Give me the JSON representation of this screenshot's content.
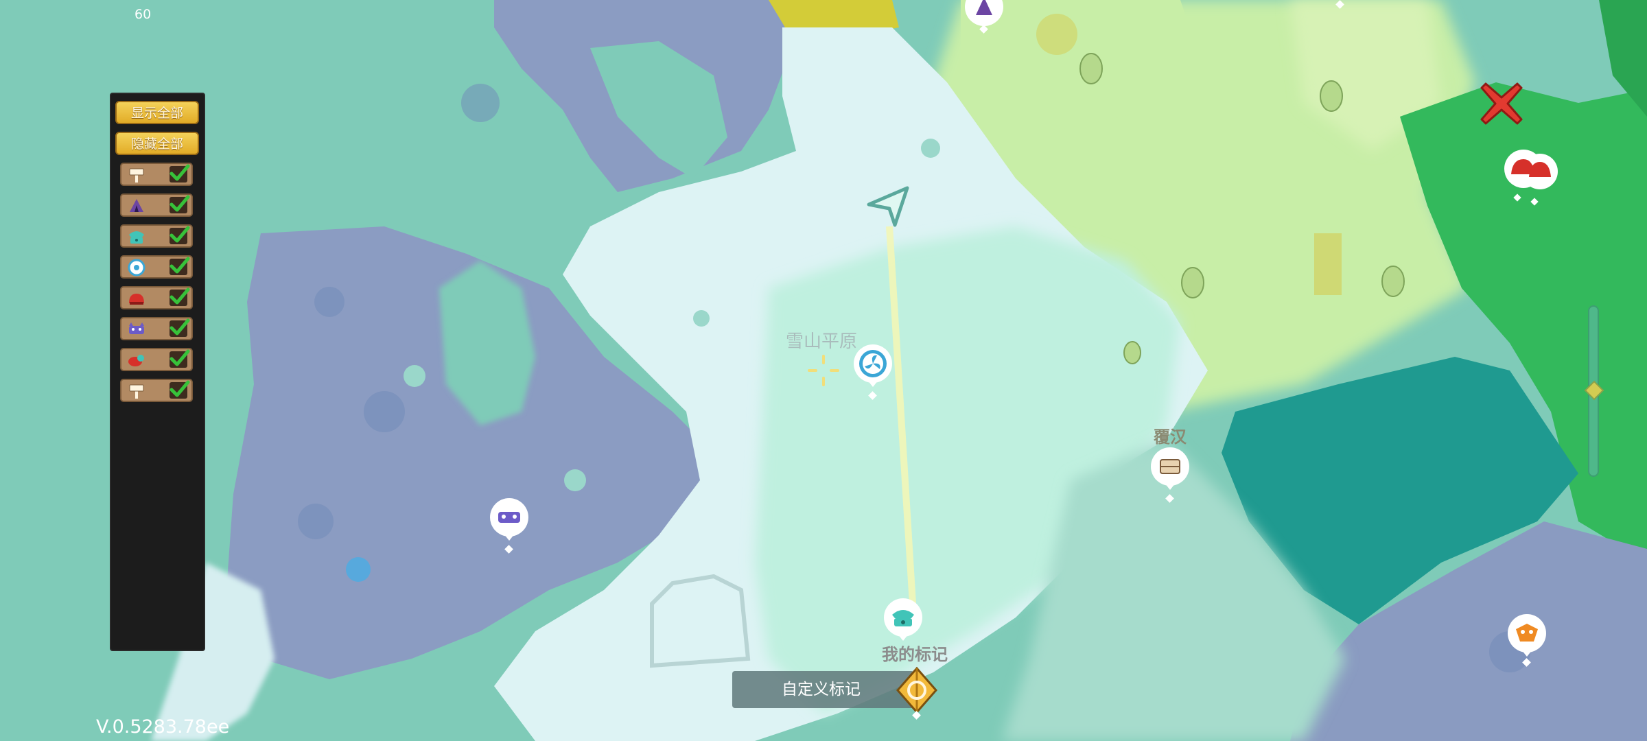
{
  "hud": {
    "fps": "60",
    "version": "V.0.5283.78ee"
  },
  "filter_panel": {
    "show_all": "显示全部",
    "hide_all": "隐藏全部",
    "rows": [
      {
        "icon": "signpost-icon",
        "checked": true
      },
      {
        "icon": "purple-tent-icon",
        "checked": true
      },
      {
        "icon": "teal-phone-icon",
        "checked": true
      },
      {
        "icon": "blue-fan-icon",
        "checked": true
      },
      {
        "icon": "red-monster-icon",
        "checked": true
      },
      {
        "icon": "purple-monster-icon",
        "checked": true
      },
      {
        "icon": "red-creature-icon",
        "checked": true
      },
      {
        "icon": "signpost-icon",
        "checked": true
      }
    ]
  },
  "map": {
    "region_name": "雪山平原",
    "npc_name": "覆汉",
    "my_marker": "我的标记"
  },
  "custom_marker_button": "自定义标记",
  "colors": {
    "panel_bg": "#1c1c1c",
    "gold_button": "#e9b833",
    "check_green": "#37c23a",
    "sea": "#7fcbb8",
    "rock": "#8b9cc2",
    "snow": "#dff4f5",
    "grass_light": "#bfe9a0",
    "forest": "#2fb35a",
    "deep_water": "#1c958e"
  }
}
